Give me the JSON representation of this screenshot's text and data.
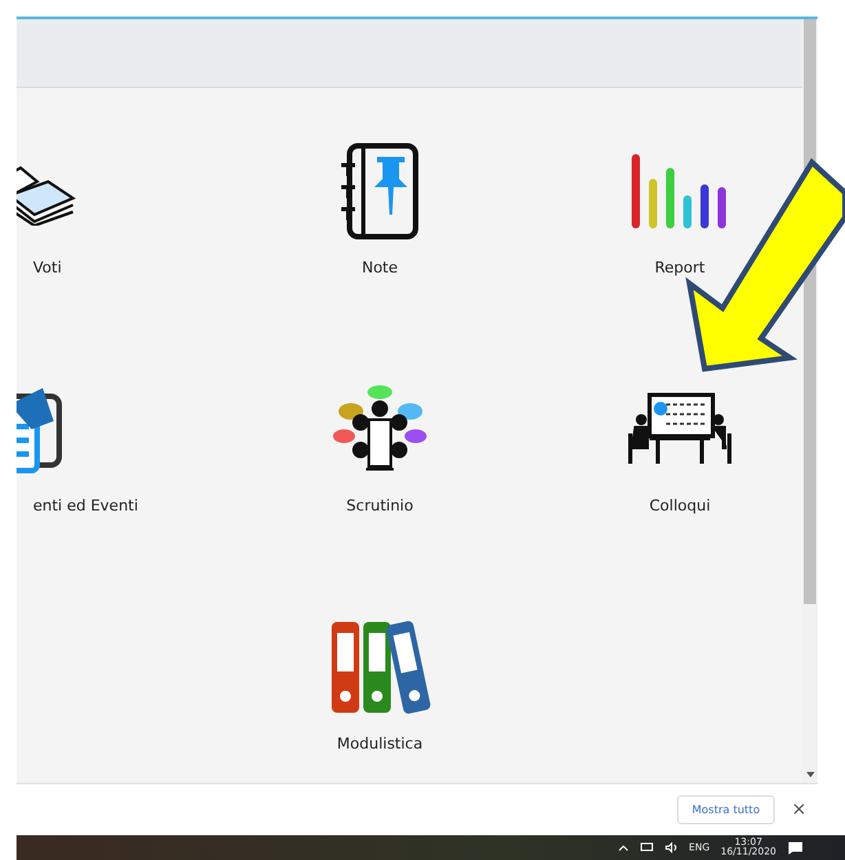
{
  "tiles": [
    {
      "label": "Voti",
      "kind": "grades"
    },
    {
      "label": "Note",
      "kind": "notes"
    },
    {
      "label": "Report",
      "kind": "report"
    },
    {
      "label": "enti ed Eventi",
      "kind": "events"
    },
    {
      "label": "Scrutinio",
      "kind": "meeting"
    },
    {
      "label": "Colloqui",
      "kind": "interview"
    },
    {
      "label": "Modulistica",
      "kind": "forms"
    }
  ],
  "download_bar": {
    "button": "Mostra tutto",
    "close": "×"
  },
  "taskbar": {
    "language": "ENG",
    "time": "13:07",
    "date": "16/11/2020"
  }
}
